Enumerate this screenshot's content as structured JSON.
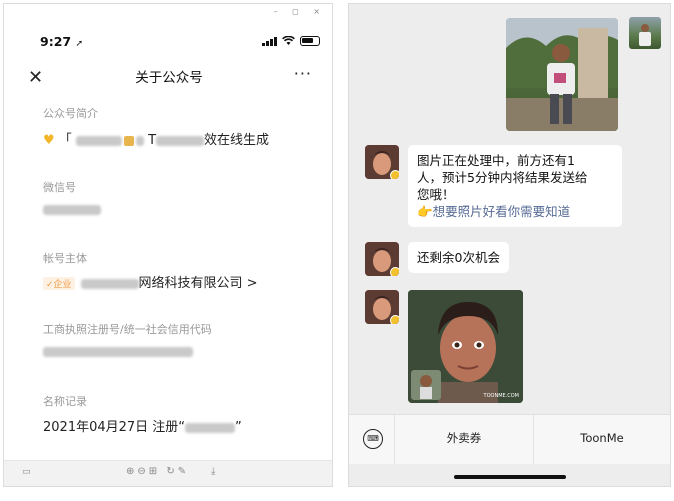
{
  "left": {
    "window_controls": "–  ◻  ×",
    "status_time": "9:27",
    "nav_title": "关于公众号",
    "intro_label": "公众号简介",
    "intro_value_mid": "T",
    "intro_value_end": "效在线生成",
    "wechat_id_label": "微信号",
    "entity_label": "帐号主体",
    "entity_tag": "✓企业",
    "entity_value": "网络科技有限公司 >",
    "license_label": "工商执照注册号/统一社会信用代码",
    "name_record_label": "名称记录",
    "name_record_value": "2021年04月27日 注册“",
    "name_record_quote_end": "”"
  },
  "right": {
    "bubble1_line1": "图片正在处理中，前方还有1",
    "bubble1_line2": "人，预计5分钟内将结果发送给",
    "bubble1_line3": "您哦！",
    "bubble1_link": "👉想要照片好看你需要知道",
    "bubble2": "还剩余0次机会",
    "image_watermark": "TOONME.COM",
    "menu_item_1": "外卖券",
    "menu_item_2": "ToonMe"
  },
  "icons": {
    "heart": "yellow-heart-icon",
    "badge": "verified-badge-icon"
  },
  "colors": {
    "link": "#576b95",
    "chat_bg": "#ededed",
    "tag_orange": "#f29b45"
  }
}
